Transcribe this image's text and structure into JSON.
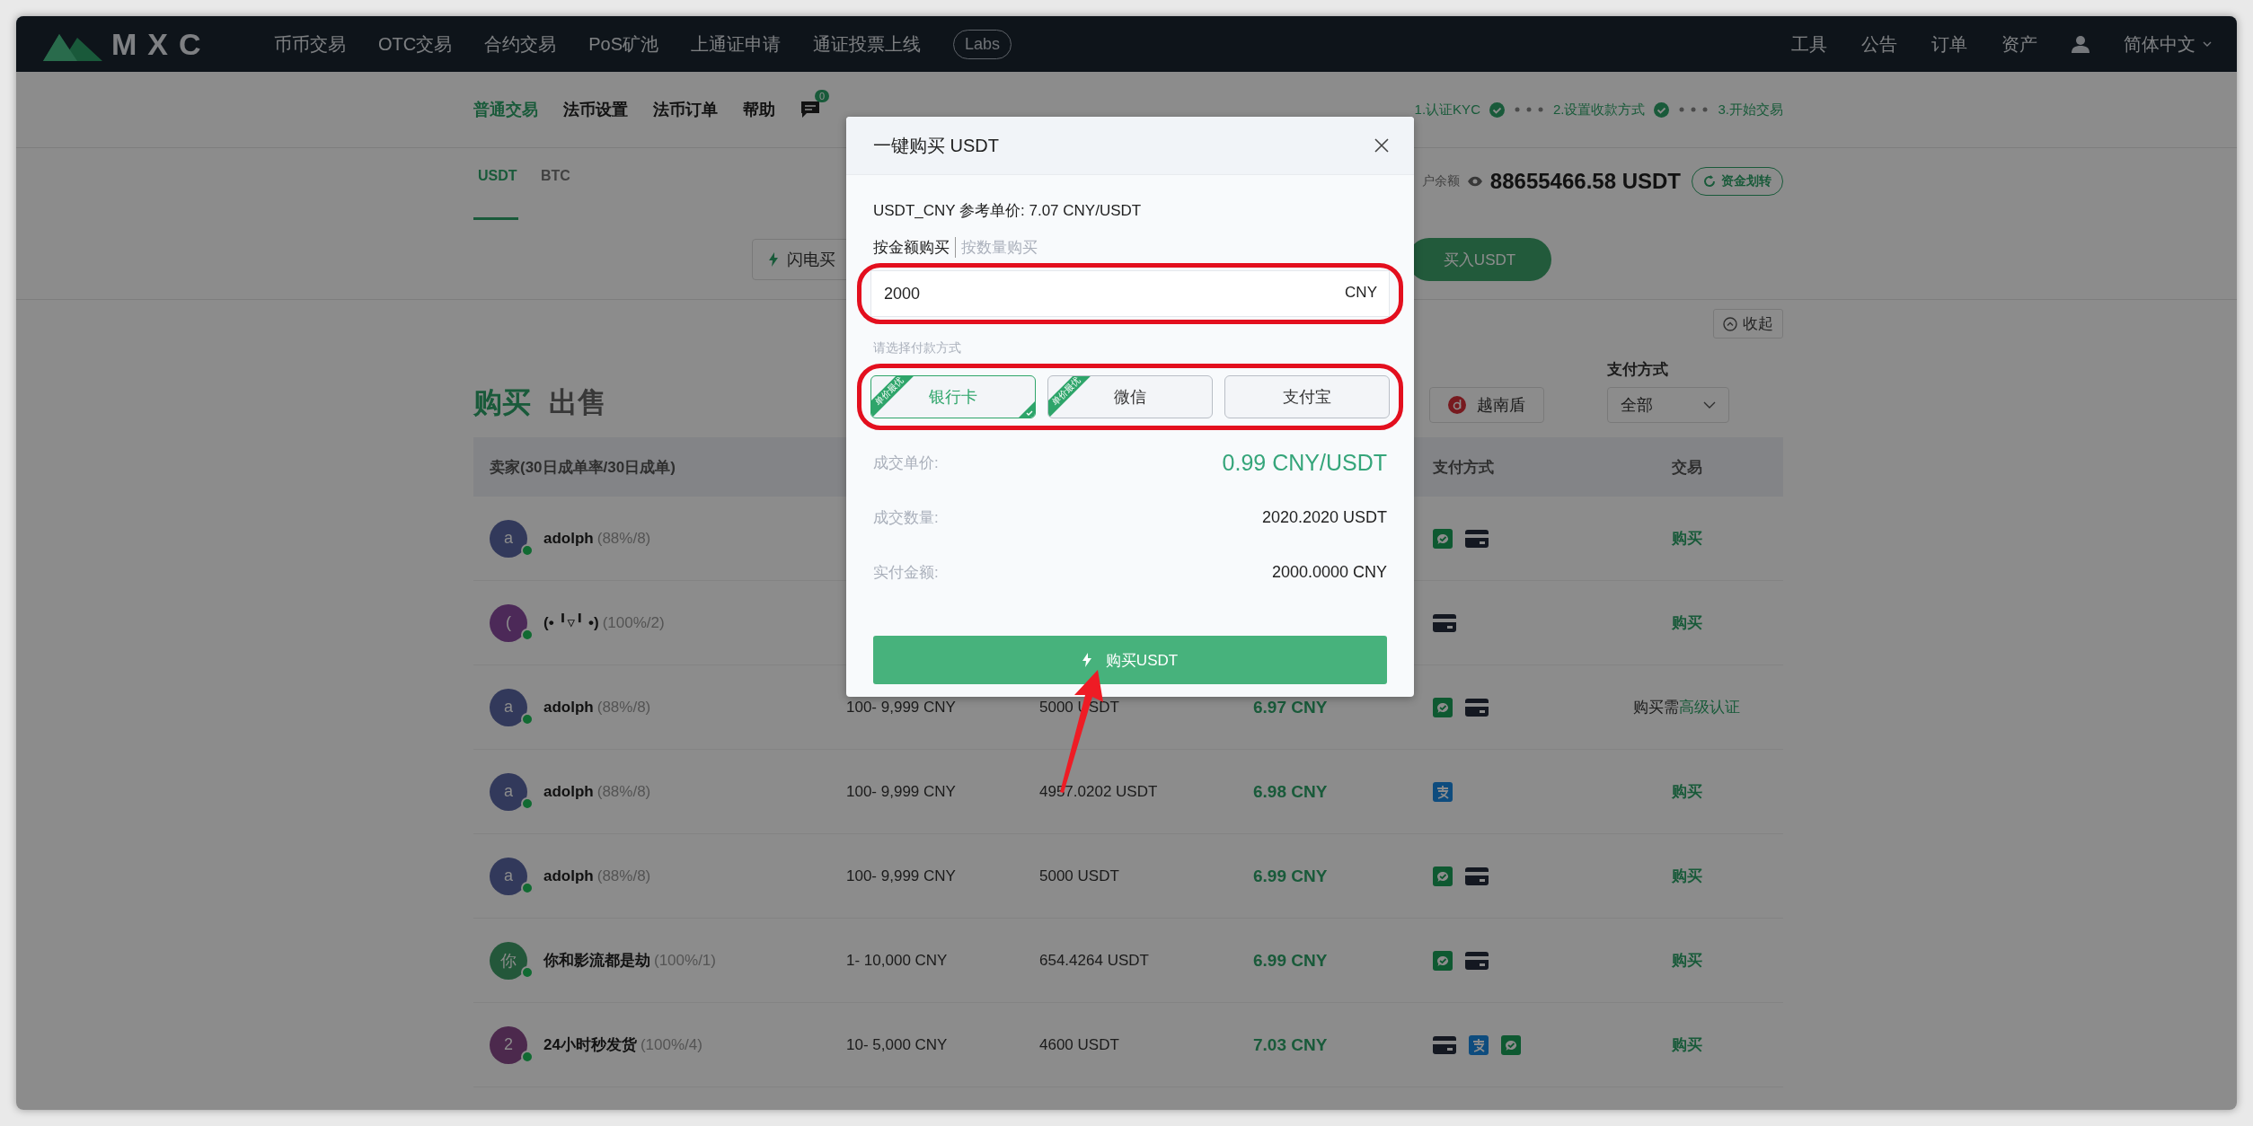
{
  "nav": {
    "logo": "MXC",
    "items": [
      {
        "label": "币币交易",
        "kind": "link"
      },
      {
        "label": "OTC交易",
        "kind": "link"
      },
      {
        "label": "合约交易",
        "kind": "link"
      },
      {
        "label": "PoS矿池",
        "kind": "link"
      },
      {
        "label": "上通证申请",
        "kind": "link"
      },
      {
        "label": "通证投票上线",
        "kind": "link"
      },
      {
        "label": "Labs",
        "kind": "pill"
      }
    ],
    "right": [
      "工具",
      "公告",
      "订单",
      "资产"
    ],
    "language": "简体中文"
  },
  "subnav": {
    "items": [
      {
        "label": "普通交易",
        "selected": true
      },
      {
        "label": "法币设置",
        "selected": false
      },
      {
        "label": "法币订单",
        "selected": false
      },
      {
        "label": "帮助",
        "selected": false
      }
    ],
    "message_badge": "0",
    "steps": [
      {
        "label": "1.认证KYC",
        "done": true
      },
      {
        "label": "2.设置收款方式",
        "done": true
      },
      {
        "label": "3.开始交易",
        "done": false
      }
    ]
  },
  "currency_tabs": [
    {
      "label": "USDT",
      "selected": true
    },
    {
      "label": "BTC",
      "selected": false
    }
  ],
  "balance": {
    "label": "户余额",
    "value": "88655466.58 USDT",
    "transfer_button": "资金划转"
  },
  "quick_buttons": {
    "flash": "闪电买",
    "buy": "买入USDT"
  },
  "collapse_button": "收起",
  "side_tabs": [
    {
      "label": "购买",
      "selected": true
    },
    {
      "label": "出售",
      "selected": false
    }
  ],
  "filters": {
    "currency": "越南盾",
    "payment_label": "支付方式",
    "payment_value": "全部"
  },
  "table": {
    "header": {
      "seller": "卖家(30日成单率/30日成单)",
      "payment": "支付方式",
      "trade": "交易"
    },
    "rows": [
      {
        "avatar": "a",
        "color": "#32395b",
        "name": "adolph",
        "stats": "(88%/8)",
        "online": true,
        "payments": [
          {
            "kind": "wechat"
          },
          {
            "kind": "card"
          }
        ],
        "action": {
          "kind": "buy",
          "label": "购买"
        }
      },
      {
        "avatar": "(",
        "color": "#4c2958",
        "name": "(• ╹▿╹ •)",
        "stats": "(100%/2)",
        "online": true,
        "payments": [
          {
            "kind": "card"
          }
        ],
        "action": {
          "kind": "buy",
          "label": "购买"
        }
      },
      {
        "avatar": "a",
        "color": "#32395b",
        "name": "adolph",
        "stats": "(88%/8)",
        "online": true,
        "limit": "100- 9,999 CNY",
        "amount": "5000 USDT",
        "price": "6.97 CNY",
        "payments": [
          {
            "kind": "wechat"
          },
          {
            "kind": "card"
          }
        ],
        "action": {
          "kind": "needs_kyc",
          "label": "购买需",
          "link": "高级认证"
        }
      },
      {
        "avatar": "a",
        "color": "#32395b",
        "name": "adolph",
        "stats": "(88%/8)",
        "online": true,
        "limit": "100- 9,999 CNY",
        "amount": "4957.0202 USDT",
        "price": "6.98 CNY",
        "payments": [
          {
            "kind": "alipay"
          }
        ],
        "action": {
          "kind": "buy",
          "label": "购买"
        }
      },
      {
        "avatar": "a",
        "color": "#32395b",
        "name": "adolph",
        "stats": "(88%/8)",
        "online": true,
        "limit": "100- 9,999 CNY",
        "amount": "5000 USDT",
        "price": "6.99 CNY",
        "payments": [
          {
            "kind": "wechat"
          },
          {
            "kind": "card"
          }
        ],
        "action": {
          "kind": "buy",
          "label": "购买"
        }
      },
      {
        "avatar": "你",
        "color": "#23573a",
        "name": "你和影流都是劫",
        "stats": "(100%/1)",
        "online": true,
        "limit": "1- 10,000 CNY",
        "amount": "654.4264 USDT",
        "price": "6.99 CNY",
        "payments": [
          {
            "kind": "wechat"
          },
          {
            "kind": "card"
          }
        ],
        "action": {
          "kind": "buy",
          "label": "购买"
        }
      },
      {
        "avatar": "2",
        "color": "#4c294d",
        "name": "24小时秒发货",
        "stats": "(100%/4)",
        "online": true,
        "limit": "10- 5,000 CNY",
        "amount": "4600 USDT",
        "price": "7.03 CNY",
        "payments": [
          {
            "kind": "card"
          },
          {
            "kind": "alipay"
          },
          {
            "kind": "wechat"
          }
        ],
        "action": {
          "kind": "buy",
          "label": "购买"
        }
      }
    ]
  },
  "modal": {
    "title": "一键购买 USDT",
    "reference": "USDT_CNY 参考单价: 7.07 CNY/USDT",
    "modes": [
      {
        "label": "按金额购买",
        "selected": true
      },
      {
        "label": "按数量购买",
        "selected": false
      }
    ],
    "amount_field": {
      "value": "2000",
      "unit": "CNY"
    },
    "payment_label": "请选择付款方式",
    "payment_options": [
      {
        "label": "银行卡",
        "selected": true,
        "ribbon": "单价最优"
      },
      {
        "label": "微信",
        "selected": false,
        "ribbon": "单价最优"
      },
      {
        "label": "支付宝",
        "selected": false
      }
    ],
    "summary": [
      {
        "label": "成交单价:",
        "value": "0.99 CNY/USDT",
        "highlight": true
      },
      {
        "label": "成交数量:",
        "value": "2020.2020 USDT",
        "highlight": false
      },
      {
        "label": "实付金额:",
        "value": "2000.0000 CNY",
        "highlight": false
      }
    ],
    "submit": "购买USDT"
  }
}
